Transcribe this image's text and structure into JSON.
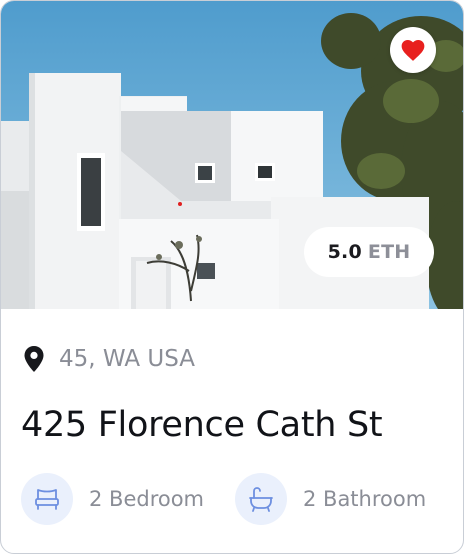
{
  "listing": {
    "price_amount": "5.0",
    "price_unit": "ETH",
    "location": "45, WA USA",
    "title": "425 Florence Cath St",
    "bedrooms_label": "2 Bedroom",
    "bathrooms_label": "2 Bathroom",
    "favorited": true
  },
  "icons": {
    "favorite": "heart-icon",
    "location": "map-pin-icon",
    "bedrooms": "bed-icon",
    "bathrooms": "bathtub-icon"
  },
  "colors": {
    "heart": "#e8201e",
    "title": "#111318",
    "muted_text": "#8a8d96",
    "icon_accent": "#6d8fe0",
    "icon_bg": "#eaf0fc",
    "sky": "#5ea6d3",
    "house": "#f3f4f5"
  }
}
